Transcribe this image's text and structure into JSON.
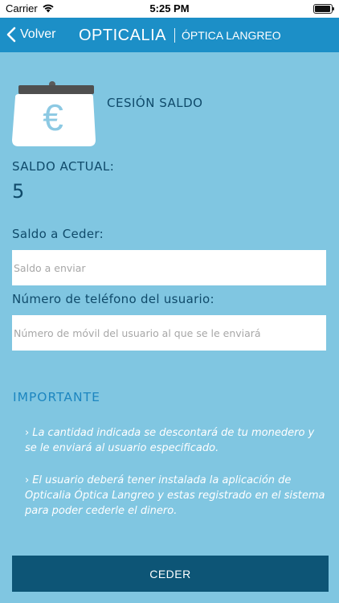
{
  "status_bar": {
    "carrier": "Carrier",
    "time": "5:25 PM"
  },
  "nav": {
    "back_label": "Volver",
    "logo": "OPTICALIA",
    "store": "ÓPTICA LANGREO"
  },
  "section": {
    "title": "CESIÓN SALDO",
    "icon": "euro-wallet-icon"
  },
  "balance": {
    "label": "SALDO ACTUAL:",
    "value": "5"
  },
  "form": {
    "amount_label": "Saldo a Ceder:",
    "amount_placeholder": "Saldo a enviar",
    "phone_label": "Número de teléfono del usuario:",
    "phone_placeholder": "Número de móvil del usuario al que se le enviará"
  },
  "important": {
    "title": "IMPORTANTE",
    "notes": [
      "La cantidad indicada se descontará de tu monedero y se le enviará al usuario especificado.",
      "El usuario deberá tener instalada la aplicación de Opticalia Óptica Langreo y estas registrado en el sistema para poder cederle el dinero."
    ]
  },
  "actions": {
    "submit_label": "CEDER"
  },
  "colors": {
    "background": "#80c6e1",
    "nav": "#1c8fc7",
    "button": "#0d5576",
    "text_dark": "#0f4a6a",
    "accent": "#1d86c0"
  }
}
